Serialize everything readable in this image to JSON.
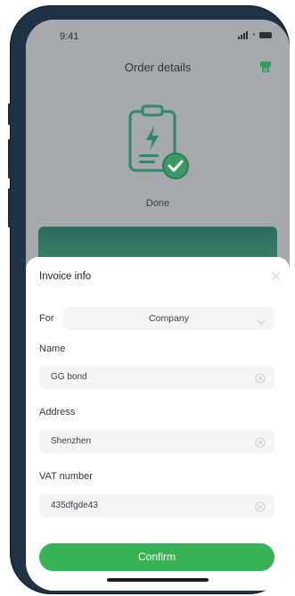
{
  "status_bar": {
    "time": "9:41"
  },
  "header": {
    "title": "Order details",
    "icon": "receipt-icon"
  },
  "order": {
    "status": "Done",
    "status_icon": "invoice-clipboard-icon"
  },
  "invoice_sheet": {
    "title": "Invoice info",
    "for_label": "For",
    "for_value": "Company",
    "fields": [
      {
        "label": "Name",
        "value": "GG bond"
      },
      {
        "label": "Address",
        "value": "Shenzhen"
      },
      {
        "label": "VAT number",
        "value": "435dfgde43"
      }
    ],
    "confirm_label": "Confirm"
  },
  "colors": {
    "accent_green": "#37b356",
    "overlay_gray": "#a5a8ad",
    "phone_frame": "#1f3346"
  }
}
